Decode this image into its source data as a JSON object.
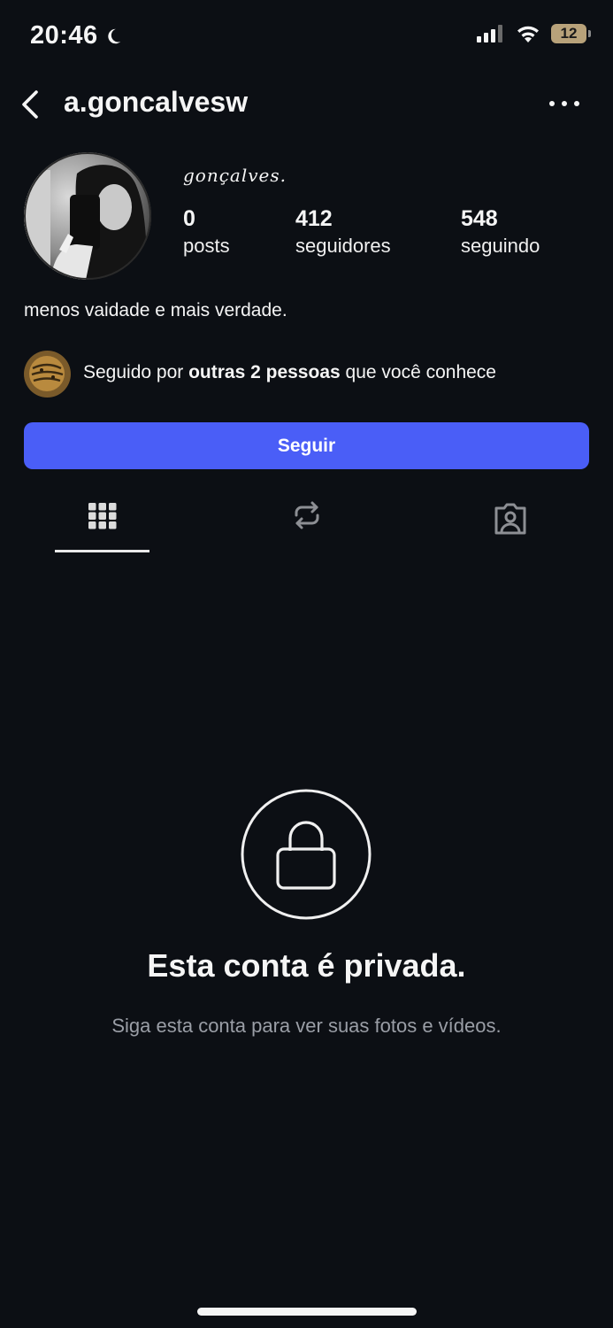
{
  "status_bar": {
    "time": "20:46",
    "battery": "12"
  },
  "header": {
    "username": "a.goncalvesw"
  },
  "profile": {
    "display_name": "gonçalves.",
    "stats": [
      {
        "value": "0",
        "label": "posts"
      },
      {
        "value": "412",
        "label": "seguidores"
      },
      {
        "value": "548",
        "label": "seguindo"
      }
    ],
    "bio": "menos vaidade e mais verdade.",
    "mutual": {
      "prefix": "Seguido por ",
      "bold": "outras 2 pessoas",
      "suffix": " que você conhece"
    },
    "follow_label": "Seguir"
  },
  "tabs": [
    {
      "icon": "grid-icon",
      "active": true
    },
    {
      "icon": "reposts-icon",
      "active": false
    },
    {
      "icon": "tagged-icon",
      "active": false
    }
  ],
  "private_notice": {
    "title": "Esta conta é privada.",
    "subtitle": "Siga esta conta para ver suas fotos e vídeos."
  },
  "colors": {
    "background": "#0c0f14",
    "accent": "#4a5ef7",
    "muted_text": "#9a9ea6"
  }
}
